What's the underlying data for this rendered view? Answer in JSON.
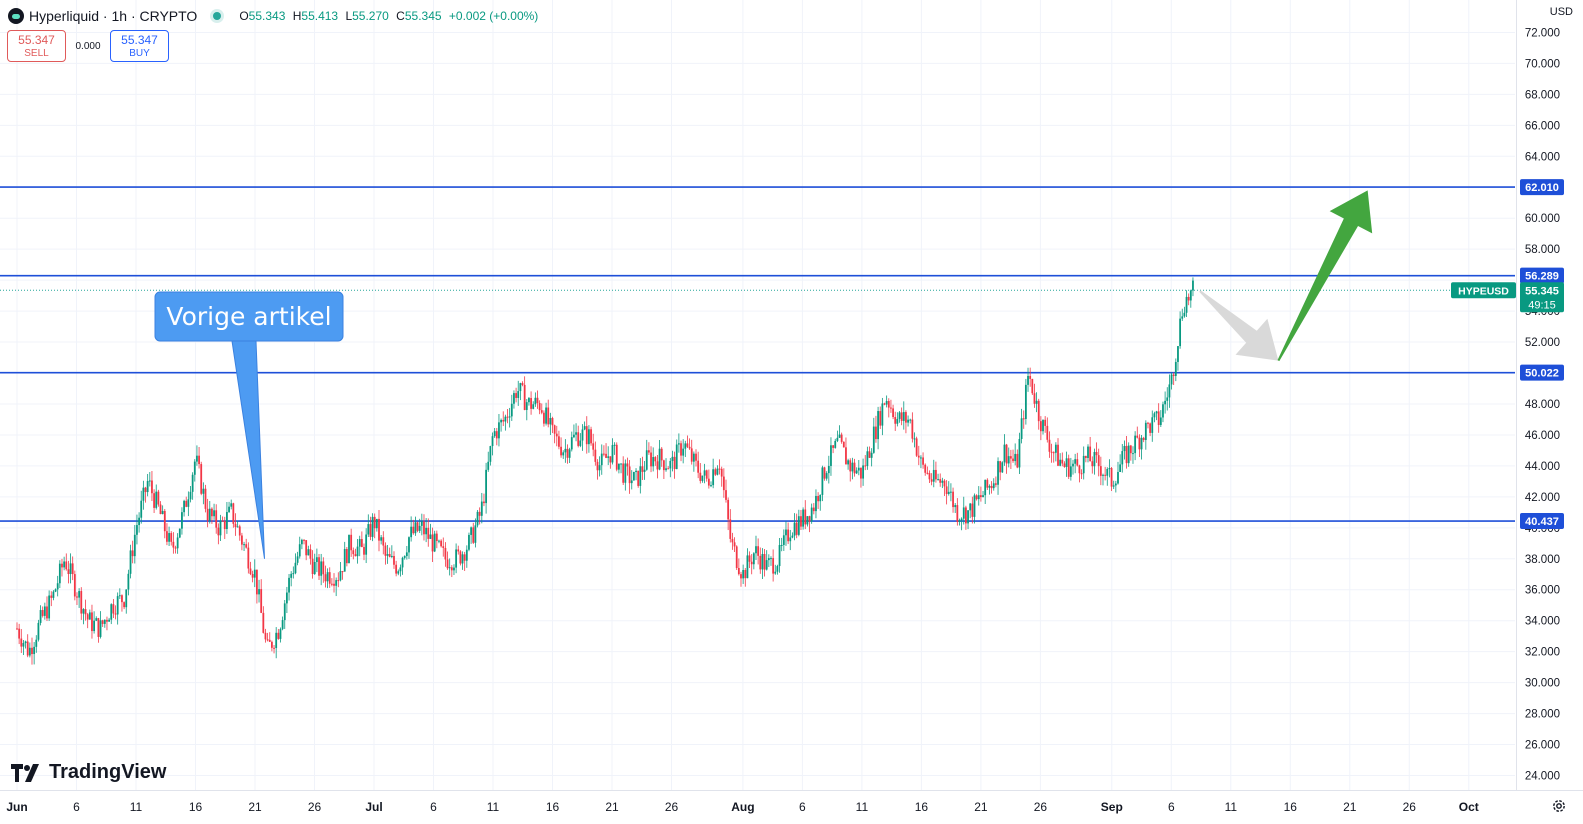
{
  "header": {
    "symbol": "Hyperliquid · 1h · CRYPTO",
    "open_label": "O",
    "open": "55.343",
    "high_label": "H",
    "high": "55.413",
    "low_label": "L",
    "low": "55.270",
    "close_label": "C",
    "close": "55.345",
    "change": "+0.002 (+0.00%)",
    "currency": "USD"
  },
  "trade": {
    "sell_price": "55.347",
    "sell_label": "SELL",
    "spread": "0.000",
    "buy_price": "55.347",
    "buy_label": "BUY"
  },
  "branding": {
    "name": "TradingView"
  },
  "colors": {
    "up": "#089981",
    "down": "#f23645",
    "level_line": "#1e4fd8",
    "callout": "#4d9bf2",
    "arrow_green": "#43a63f",
    "arrow_grey": "#d9d9d9"
  },
  "chart_data": {
    "type": "candlestick",
    "symbol_tag": "HYPEUSD",
    "ylim": [
      23,
      72
    ],
    "y_ticks": [
      "24.000",
      "26.000",
      "28.000",
      "30.000",
      "32.000",
      "34.000",
      "36.000",
      "38.000",
      "40.000",
      "42.000",
      "44.000",
      "46.000",
      "48.000",
      "50.000",
      "52.000",
      "54.000",
      "56.000",
      "58.000",
      "60.000",
      "62.000",
      "64.000",
      "66.000",
      "68.000",
      "70.000",
      "72.000"
    ],
    "x_ticks": [
      "Jun",
      "6",
      "11",
      "16",
      "21",
      "26",
      "Jul",
      "6",
      "11",
      "16",
      "21",
      "26",
      "Aug",
      "6",
      "11",
      "16",
      "21",
      "26",
      "Sep",
      "6",
      "11",
      "16",
      "21",
      "26",
      "Oct"
    ],
    "x_tick_days": [
      0,
      5,
      10,
      15,
      20,
      25,
      30,
      35,
      40,
      45,
      50,
      55,
      61,
      66,
      71,
      76,
      81,
      86,
      92,
      97,
      102,
      107,
      112,
      117,
      122
    ],
    "last_price": "55.345",
    "last_price_value": 55.345,
    "countdown": "49:15",
    "levels": [
      {
        "label": "62.010",
        "value": 62.01
      },
      {
        "label": "56.289",
        "value": 56.289
      },
      {
        "label": "50.022",
        "value": 50.022
      },
      {
        "label": "40.437",
        "value": 40.437
      }
    ],
    "price_path": [
      [
        0,
        33.5
      ],
      [
        1,
        32
      ],
      [
        2,
        34
      ],
      [
        3,
        35.5
      ],
      [
        4,
        38
      ],
      [
        5,
        36
      ],
      [
        6,
        34
      ],
      [
        7,
        33.5
      ],
      [
        8,
        35
      ],
      [
        9,
        35.5
      ],
      [
        10,
        40
      ],
      [
        11,
        43
      ],
      [
        12,
        41
      ],
      [
        13,
        38.5
      ],
      [
        14,
        41
      ],
      [
        15,
        44.5
      ],
      [
        16,
        41
      ],
      [
        17,
        40
      ],
      [
        18,
        41
      ],
      [
        19,
        39
      ],
      [
        20,
        37
      ],
      [
        21,
        32
      ],
      [
        22,
        33.5
      ],
      [
        23,
        37
      ],
      [
        24,
        39
      ],
      [
        25,
        37.5
      ],
      [
        26,
        37
      ],
      [
        27,
        37
      ],
      [
        28,
        39
      ],
      [
        29,
        38.5
      ],
      [
        30,
        40.5
      ],
      [
        31,
        38
      ],
      [
        32,
        37.5
      ],
      [
        33,
        39.5
      ],
      [
        34,
        40
      ],
      [
        35,
        39
      ],
      [
        36,
        38
      ],
      [
        37,
        38
      ],
      [
        38,
        39
      ],
      [
        39,
        41
      ],
      [
        40,
        46
      ],
      [
        41,
        47
      ],
      [
        42,
        49
      ],
      [
        43,
        48
      ],
      [
        44,
        48
      ],
      [
        45,
        46
      ],
      [
        46,
        45
      ],
      [
        47,
        46
      ],
      [
        48,
        46
      ],
      [
        49,
        44
      ],
      [
        50,
        45
      ],
      [
        51,
        43.5
      ],
      [
        52,
        43
      ],
      [
        53,
        44.5
      ],
      [
        54,
        44.5
      ],
      [
        55,
        44
      ],
      [
        56,
        45.5
      ],
      [
        57,
        44
      ],
      [
        58,
        43
      ],
      [
        59,
        44.5
      ],
      [
        60,
        39
      ],
      [
        61,
        37
      ],
      [
        62,
        38.5
      ],
      [
        63,
        37.5
      ],
      [
        64,
        38
      ],
      [
        65,
        40
      ],
      [
        66,
        40.5
      ],
      [
        67,
        41.5
      ],
      [
        68,
        44
      ],
      [
        69,
        45.5
      ],
      [
        70,
        44
      ],
      [
        71,
        43.5
      ],
      [
        72,
        46
      ],
      [
        73,
        48.5
      ],
      [
        74,
        47
      ],
      [
        75,
        47
      ],
      [
        76,
        44
      ],
      [
        77,
        43
      ],
      [
        78,
        43
      ],
      [
        79,
        41
      ],
      [
        80,
        41
      ],
      [
        81,
        42
      ],
      [
        82,
        43
      ],
      [
        83,
        45
      ],
      [
        84,
        44
      ],
      [
        85,
        50
      ],
      [
        86,
        47
      ],
      [
        87,
        45
      ],
      [
        88,
        44
      ],
      [
        89,
        44
      ],
      [
        90,
        44.5
      ],
      [
        91,
        44
      ],
      [
        92,
        43
      ],
      [
        93,
        44.5
      ],
      [
        94,
        45.5
      ],
      [
        95,
        46.5
      ],
      [
        96,
        47
      ],
      [
        97,
        49.5
      ],
      [
        98,
        54.5
      ],
      [
        99,
        55.4
      ]
    ],
    "annotations": [
      {
        "text": "Vorige artikel",
        "type": "callout",
        "points_to_day": 20.8,
        "points_to_value": 38.0
      },
      {
        "text": "",
        "type": "arrow",
        "color": "grey",
        "from_day": 99.4,
        "from_value": 55.3,
        "to_day": 106,
        "to_value": 50.8
      },
      {
        "text": "",
        "type": "arrow",
        "color": "green",
        "from_day": 106,
        "from_value": 50.8,
        "to_day": 113.5,
        "to_value": 61.8
      }
    ]
  }
}
